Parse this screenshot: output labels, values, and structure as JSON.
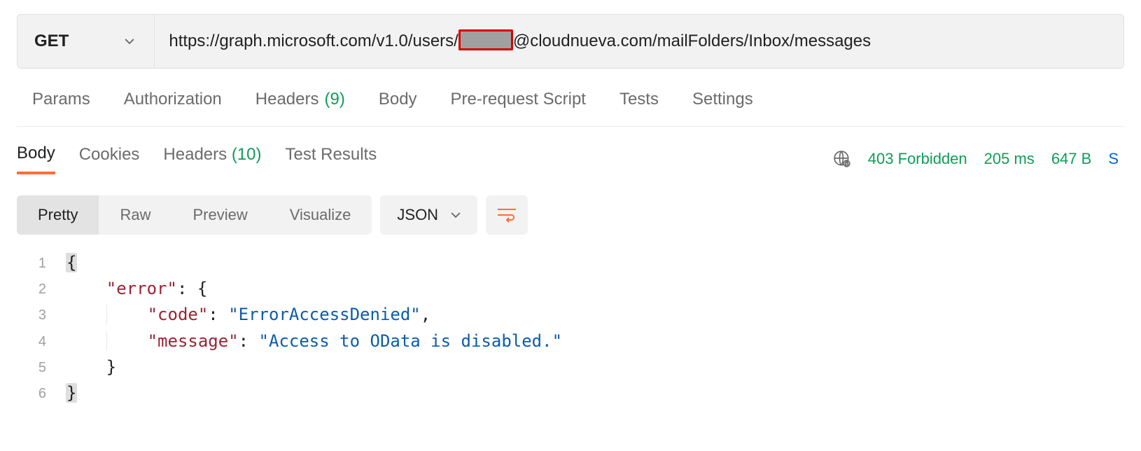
{
  "request": {
    "method": "GET",
    "url_before": "https://graph.microsoft.com/v1.0/users/",
    "url_after": "@cloudnueva.com/mailFolders/Inbox/messages"
  },
  "req_tabs": {
    "params": "Params",
    "authorization": "Authorization",
    "headers_label": "Headers",
    "headers_count": "(9)",
    "body": "Body",
    "prerequest": "Pre-request Script",
    "tests": "Tests",
    "settings": "Settings"
  },
  "resp_tabs": {
    "body": "Body",
    "cookies": "Cookies",
    "headers_label": "Headers",
    "headers_count": "(10)",
    "test_results": "Test Results"
  },
  "resp_meta": {
    "status": "403 Forbidden",
    "time": "205 ms",
    "size": "647 B",
    "save": "S"
  },
  "view": {
    "pretty": "Pretty",
    "raw": "Raw",
    "preview": "Preview",
    "visualize": "Visualize",
    "format": "JSON"
  },
  "json_lines": {
    "l1_num": "1",
    "l1": "{",
    "l2_num": "2",
    "l2_key": "\"error\"",
    "l2_after": ": {",
    "l3_num": "3",
    "l3_key": "\"code\"",
    "l3_mid": ": ",
    "l3_val": "\"ErrorAccessDenied\"",
    "l3_end": ",",
    "l4_num": "4",
    "l4_key": "\"message\"",
    "l4_mid": ": ",
    "l4_val": "\"Access to OData is disabled.\"",
    "l5_num": "5",
    "l5": "}",
    "l6_num": "6",
    "l6": "}"
  }
}
